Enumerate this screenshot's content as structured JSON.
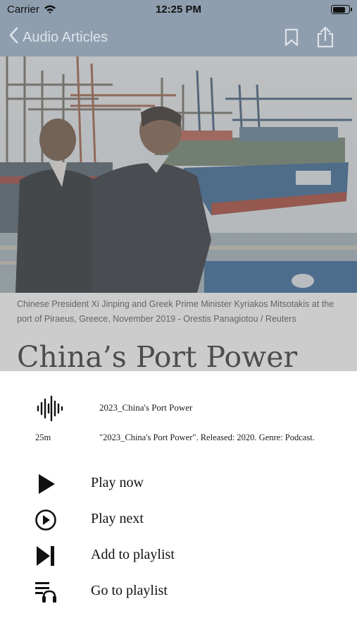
{
  "status_bar": {
    "carrier": "Carrier",
    "time": "12:25 PM",
    "battery_level": 0.85
  },
  "nav": {
    "back_label": "Audio Articles",
    "back_icon": "chevron-left-icon",
    "bookmark_icon": "bookmark-icon",
    "share_icon": "share-icon"
  },
  "article": {
    "caption": "Chinese President Xi Jinping and Greek Prime Minister Kyriakos Mitsotakis at the port of Piraeus, Greece, November 2019 - Orestis Panagiotou / Reuters",
    "headline": "China’s Port Power"
  },
  "sheet": {
    "track_icon": "waveform-icon",
    "track_title": "2023_China's Port Power",
    "duration": "25m",
    "description": "\"2023_China's Port Power\". Released: 2020. Genre: Podcast.",
    "items": [
      {
        "label": "Play now",
        "icon": "play-icon"
      },
      {
        "label": "Play next",
        "icon": "play-circle-icon"
      },
      {
        "label": "Add to playlist",
        "icon": "skip-next-icon"
      },
      {
        "label": "Go to playlist",
        "icon": "playlist-headphones-icon"
      }
    ]
  },
  "colors": {
    "nav_background": "#8e9eae",
    "nav_tint": "#dde3ea",
    "sheet_background": "#ffffff",
    "text_primary": "#111111"
  }
}
